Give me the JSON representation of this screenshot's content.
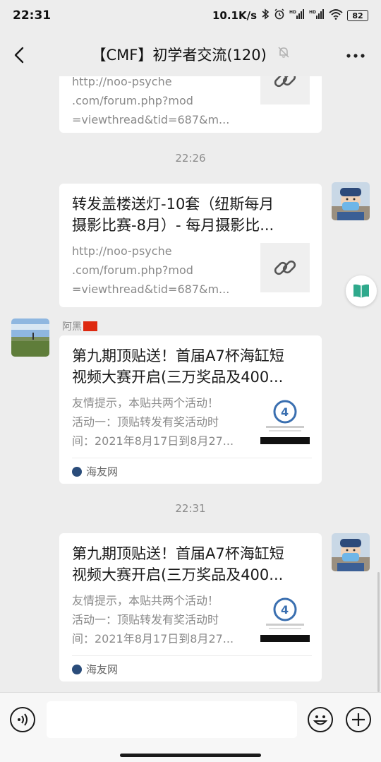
{
  "status_bar": {
    "time": "22:31",
    "net_speed": "10.1K/s",
    "battery": "82",
    "icons": [
      "bluetooth-icon",
      "alarm-icon",
      "signal-hd-icon",
      "signal-hd-icon",
      "wifi-icon",
      "battery-icon"
    ]
  },
  "nav": {
    "title": "【CMF】初学者交流(120)",
    "back_icon": "back-chevron-icon",
    "mute_icon": "bell-muted-icon",
    "more_icon": "more-dots-icon"
  },
  "messages": [
    {
      "id": "m1",
      "desc": "http://noo-psyche.com/forum.php?mod=viewthread&tid=687&m...",
      "desc_lines": [
        "http://noo-psyche",
        ".com/forum.php?mod",
        "=viewthread&tid=687&m..."
      ],
      "thumb_icon": "link-icon"
    },
    {
      "timestamp": "22:26"
    },
    {
      "id": "m2",
      "title": "转发盖楼送灯-10套（纽斯每月摄影比赛-8月）- 每月摄影比...",
      "title_lines": [
        "转发盖楼送灯-10套（纽斯每月",
        "摄影比赛-8月）- 每月摄影比..."
      ],
      "desc_lines": [
        "http://noo-psyche",
        ".com/forum.php?mod",
        "=viewthread&tid=687&m..."
      ],
      "thumb_icon": "link-icon"
    },
    {
      "id": "m3",
      "sender": "阿黑",
      "title_lines": [
        "第九期顶贴送！首届A7杯海缸短",
        "视频大赛开启(三万奖品及400..."
      ],
      "desc_lines": [
        "友情提示，本贴共两个活动！",
        "活动一：顶贴转发有奖活动时",
        "间：2021年8月17日到8月27..."
      ],
      "source": "海友网"
    },
    {
      "timestamp": "22:31"
    },
    {
      "id": "m4",
      "title_lines": [
        "第九期顶贴送！首届A7杯海缸短",
        "视频大赛开启(三万奖品及400..."
      ],
      "desc_lines": [
        "友情提示，本贴共两个活动！",
        "活动一：顶贴转发有奖活动时",
        "间：2021年8月17日到8月27..."
      ],
      "source": "海友网"
    }
  ],
  "input_bar": {
    "voice_icon": "voice-icon",
    "emoji_icon": "emoji-icon",
    "plus_icon": "plus-icon",
    "placeholder": ""
  }
}
